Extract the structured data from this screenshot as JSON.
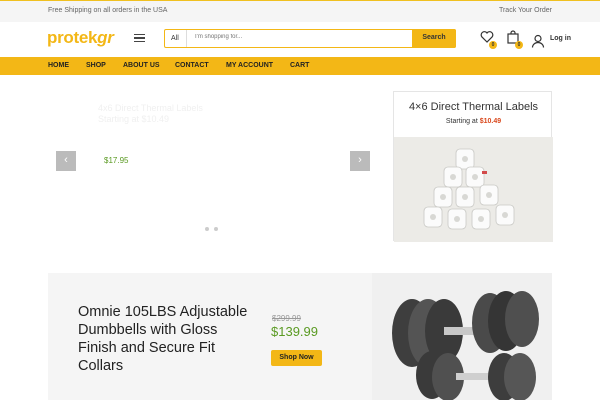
{
  "topbar": {
    "shipping_text": "Free Shipping on all orders in the USA",
    "track_text": "Track Your Order"
  },
  "header": {
    "logo_main": "protek",
    "logo_suffix": "gr",
    "search": {
      "category": "All",
      "placeholder": "I'm shopping for...",
      "button": "Search"
    },
    "wishlist_count": "0",
    "cart_count": "0",
    "login_label": "Log in"
  },
  "nav": {
    "items": [
      "HOME",
      "SHOP",
      "ABOUT US",
      "CONTACT",
      "MY ACCOUNT",
      "CART"
    ]
  },
  "hero": {
    "ghost_line1": "4x6 Direct Thermal Labels",
    "ghost_line2": "Starting at $10.49",
    "price": "$17.95",
    "prev": "‹",
    "next": "›"
  },
  "promo": {
    "title": "4×6 Direct Thermal Labels",
    "sub_prefix": "Starting at ",
    "sub_price": "$10.49"
  },
  "banner": {
    "title": "Omnie 105LBS Adjustable Dumbbells with Gloss Finish and Secure Fit Collars",
    "old_price": "$299.99",
    "new_price": "$139.99",
    "button": "Shop Now"
  },
  "colors": {
    "accent": "#f3b716",
    "price_green": "#5a9a22",
    "sale_red": "#d9481c"
  }
}
